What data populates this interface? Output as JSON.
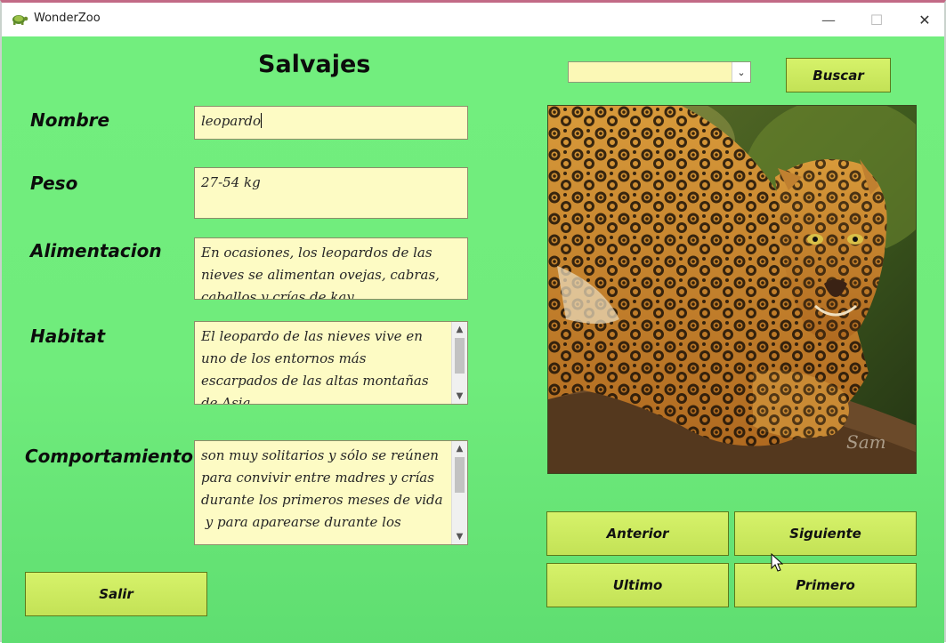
{
  "window": {
    "title": "WonderZoo",
    "controls": {
      "minimize": "—",
      "maximize": "☐",
      "close": "✕"
    }
  },
  "form": {
    "title": "Salvajes",
    "labels": {
      "nombre": "Nombre",
      "peso": "Peso",
      "alimentacion": "Alimentacion",
      "habitat": "Habitat",
      "comportamiento": "Comportamiento"
    },
    "values": {
      "nombre": "leopardo",
      "peso": "27-54 kg",
      "alimentacion": "En ocasiones, los leopardos de las nieves se alimentan ovejas, cabras, caballos y crías de kay",
      "habitat": "El leopardo de las nieves vive en uno de los entornos más escarpados de las altas montañas de Asia",
      "comportamiento": "son muy solitarios y sólo se reúnen para convivir entre madres y crías durante los primeros meses de vida\n y para aparearse durante los"
    }
  },
  "search": {
    "combo_value": "",
    "button_label": "Buscar"
  },
  "photo": {
    "subject": "jaguar-photo",
    "signature": "Sam"
  },
  "nav": {
    "anterior": "Anterior",
    "siguiente": "Siguiente",
    "ultimo": "Ultimo",
    "primero": "Primero"
  },
  "salir_label": "Salir",
  "colors": {
    "form_background": "#72ee7e",
    "button": "#c9e85c",
    "field": "#fdfbc4"
  }
}
